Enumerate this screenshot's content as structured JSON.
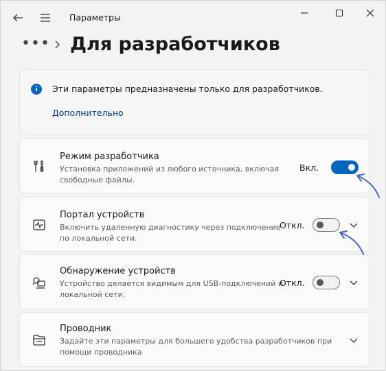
{
  "window": {
    "title": "Параметры"
  },
  "header": {
    "more": "•••",
    "page_title": "Для разработчиков"
  },
  "info": {
    "text": "Эти параметры предназначены только для разработчиков.",
    "link": "Дополнительно"
  },
  "settings": [
    {
      "title": "Режим разработчика",
      "desc": "Установка приложений из любого источника, включая свободные файлы.",
      "state": "Вкл.",
      "toggle": true,
      "expandable": false,
      "icon": "developer-tools-icon"
    },
    {
      "title": "Портал устройств",
      "desc": "Включить удаленную диагностику через подключение по локальной сети.",
      "state": "Откл.",
      "toggle": false,
      "expandable": true,
      "icon": "device-portal-icon"
    },
    {
      "title": "Обнаружение устройств",
      "desc": "Устройство делается видимым для USB-подключений и локальной сети.",
      "state": "Откл.",
      "toggle": false,
      "expandable": true,
      "icon": "device-discovery-icon"
    },
    {
      "title": "Проводник",
      "desc": "Задайте эти параметры для большего удобства разработчиков при помощи проводника",
      "expandable": true,
      "icon": "file-explorer-icon"
    }
  ],
  "colors": {
    "accent": "#0067c0",
    "link": "#003e92",
    "annotation_arrow": "#4a66c0"
  }
}
